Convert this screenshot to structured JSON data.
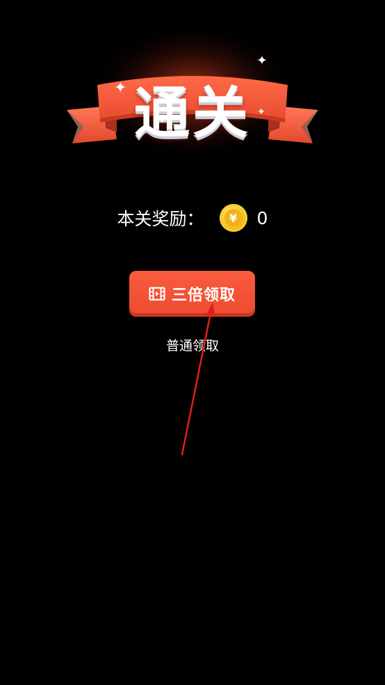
{
  "banner": {
    "title": "通关",
    "sparkle": "✦"
  },
  "reward": {
    "label": "本关奖励：",
    "coin_symbol": "¥",
    "value": "0"
  },
  "buttons": {
    "triple_claim": "三倍领取",
    "normal_claim": "普通领取"
  },
  "icons": {
    "banner": "ribbon-icon",
    "coin": "coin-icon",
    "video": "video-icon",
    "annotation": "arrow-icon"
  },
  "colors": {
    "background": "#000000",
    "ribbon": "#ef5638",
    "button": "#f4533a",
    "coin": "#f6c21c",
    "annotation": "#e0201a"
  }
}
